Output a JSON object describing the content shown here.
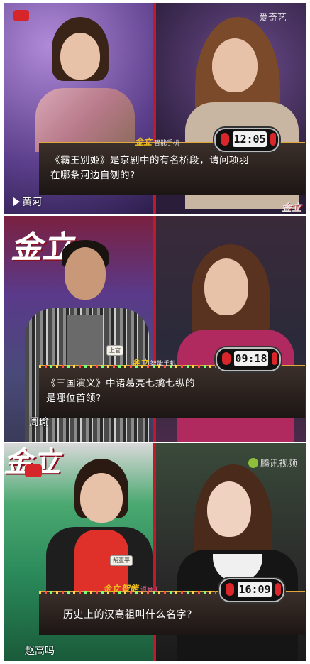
{
  "frames": [
    {
      "question_book": "《霸王别姬》",
      "question_line1_rest": "是京剧中的有名桥段，请问项羽",
      "question_line2": "在哪条河边自刎的?",
      "timer": "12:05",
      "answer": "黄河",
      "sponsor": "金立",
      "sponsor_sub": "智能手机",
      "watermark": "爱奇艺",
      "colors": {
        "left_bg": "#7a5aa8",
        "right_bg": "#3a2a5a",
        "accent": "#c01a2a"
      }
    },
    {
      "question_book": "《三国演义》",
      "question_line1_rest": "中诸葛亮七擒七纵的",
      "question_line2": "是哪位首领?",
      "timer": "09:18",
      "answer": "周瑜",
      "sponsor": "金立",
      "sponsor_sub": "智能手机",
      "logo": "金立",
      "colors": {
        "left_bg": "#5a4a8a",
        "right_bg": "#2c2a44",
        "accent": "#c01a2a"
      }
    },
    {
      "question_line1": "历史上的汉高祖叫什么名字?",
      "timer": "16:09",
      "answer": "赵高吗",
      "sponsor": "金立",
      "sponsor_mid": "智能",
      "sponsor_sub": "语音王",
      "watermark": "腾讯视频",
      "logo": "金立",
      "colors": {
        "left_bg": "#2f8a5a",
        "right_bg": "#2a3a2a",
        "accent": "#c01a2a"
      }
    }
  ]
}
